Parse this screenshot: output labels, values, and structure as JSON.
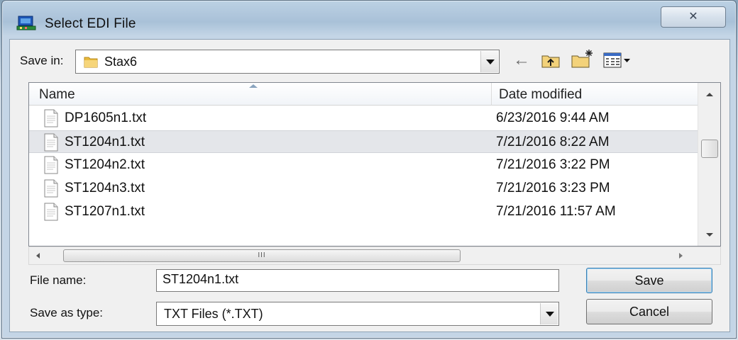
{
  "window": {
    "title": "Select EDI File",
    "close_glyph": "✕"
  },
  "save_in": {
    "label": "Save in:",
    "value": "Stax6"
  },
  "toolbar": {
    "back_glyph": "←",
    "icons": [
      "back-arrow-icon",
      "up-folder-icon",
      "new-folder-icon",
      "view-menu-icon"
    ]
  },
  "columns": {
    "name": "Name",
    "date": "Date modified"
  },
  "files": [
    {
      "name": "DP1605n1.txt",
      "date": "6/23/2016 9:44 AM",
      "selected": false
    },
    {
      "name": "ST1204n1.txt",
      "date": "7/21/2016 8:22 AM",
      "selected": true
    },
    {
      "name": "ST1204n2.txt",
      "date": "7/21/2016 3:22 PM",
      "selected": false
    },
    {
      "name": "ST1204n3.txt",
      "date": "7/21/2016 3:23 PM",
      "selected": false
    },
    {
      "name": "ST1207n1.txt",
      "date": "7/21/2016 11:57 AM",
      "selected": false
    }
  ],
  "hscroll": {
    "grip": "III"
  },
  "file_name": {
    "label": "File name:",
    "value": "ST1204n1.txt"
  },
  "save_as_type": {
    "label": "Save as type:",
    "value": "TXT Files (*.TXT)"
  },
  "buttons": {
    "save": "Save",
    "cancel": "Cancel"
  },
  "colors": {
    "selection": "#e4e6ea",
    "folder": "#e8b93c",
    "titlebar": "#a9c1d8"
  }
}
